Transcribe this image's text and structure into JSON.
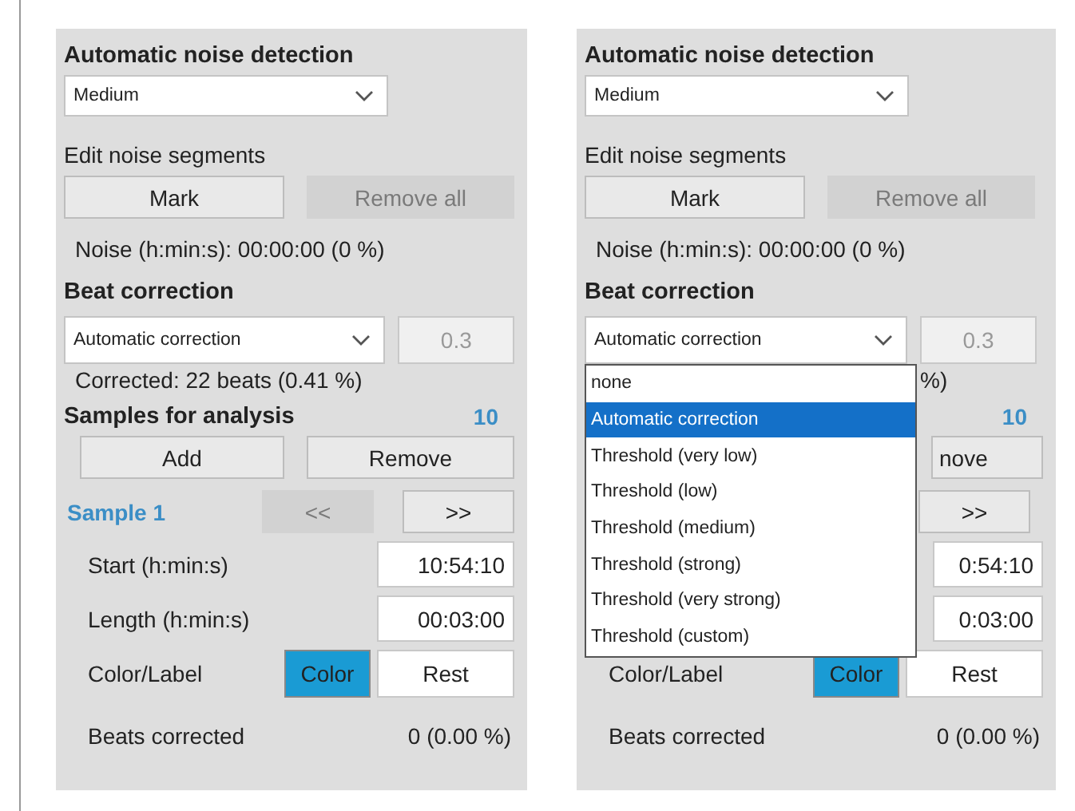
{
  "panels": [
    {
      "noise_detection": {
        "title": "Automatic noise detection",
        "value": "Medium"
      },
      "noise_segments": {
        "title": "Edit noise segments",
        "buttons": [
          {
            "label": "Mark",
            "disabled": false
          },
          {
            "label": "Remove all",
            "disabled": true
          }
        ]
      },
      "noise_readout": "Noise (h:min:s): 00:00:00 (0 %)",
      "beat_correction": {
        "title": "Beat correction",
        "method": "Automatic correction",
        "threshold": "0.3",
        "expanded": false
      },
      "corrected": "Corrected: 22 beats (0.41 %)",
      "samples": {
        "title": "Samples for analysis",
        "count": "10",
        "buttons": [
          {
            "label": "Add"
          },
          {
            "label": "Remove"
          }
        ],
        "sample_label": "Sample 1",
        "nav": [
          {
            "label": "<<",
            "disabled": true
          },
          {
            "label": ">>",
            "disabled": false
          }
        ],
        "fields": [
          {
            "label": "Start (h:min:s)",
            "value": "10:54:10"
          },
          {
            "label": "Length (h:min:s)",
            "value": "00:03:00"
          }
        ],
        "color_label": {
          "label": "Color/Label",
          "color_button": "Color",
          "tag": "Rest"
        },
        "beats_corrected": {
          "label": "Beats corrected",
          "value": "0 (0.00 %)"
        }
      }
    },
    {
      "noise_detection": {
        "title": "Automatic noise detection",
        "value": "Medium"
      },
      "noise_segments": {
        "title": "Edit noise segments",
        "buttons": [
          {
            "label": "Mark",
            "disabled": false
          },
          {
            "label": "Remove all",
            "disabled": true
          }
        ]
      },
      "noise_readout": "Noise (h:min:s): 00:00:00 (0 %)",
      "beat_correction": {
        "title": "Beat correction",
        "method": "Automatic correction",
        "threshold": "0.3",
        "expanded": true,
        "options": [
          {
            "label": "none",
            "selected": false
          },
          {
            "label": "Automatic correction",
            "selected": true
          },
          {
            "label": "Threshold (very low)",
            "selected": false
          },
          {
            "label": "Threshold (low)",
            "selected": false
          },
          {
            "label": "Threshold (medium)",
            "selected": false
          },
          {
            "label": "Threshold (strong)",
            "selected": false
          },
          {
            "label": "Threshold (very strong)",
            "selected": false
          },
          {
            "label": "Threshold (custom)",
            "selected": false
          }
        ]
      },
      "corrected": "%)",
      "samples": {
        "count": "10",
        "buttons": [
          {
            "label": "nove"
          }
        ],
        "nav": [
          {
            "label": ">>",
            "disabled": false
          }
        ],
        "fields": [
          {
            "value": "0:54:10"
          },
          {
            "value": "0:03:00"
          }
        ],
        "color_label": {
          "label": "Color/Label",
          "color_button": "Color",
          "tag": "Rest"
        },
        "beats_corrected": {
          "label": "Beats corrected",
          "value": "0 (0.00 %)"
        }
      }
    }
  ]
}
